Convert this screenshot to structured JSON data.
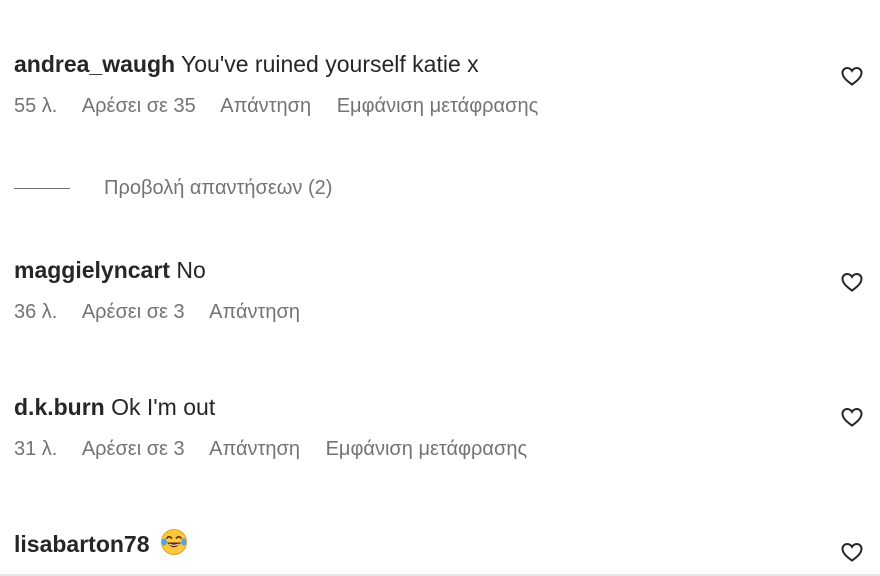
{
  "comments": [
    {
      "username": "andrea_waugh",
      "text": "You've ruined yourself katie x",
      "time": "55 λ.",
      "likes": "Αρέσει σε 35",
      "reply": "Απάντηση",
      "translate": "Εμφάνιση μετάφρασης"
    },
    {
      "username": "maggielyncart",
      "text": "No",
      "time": "36 λ.",
      "likes": "Αρέσει σε 3",
      "reply": "Απάντηση"
    },
    {
      "username": "d.k.burn",
      "text": "Ok I'm out",
      "time": "31 λ.",
      "likes": "Αρέσει σε 3",
      "reply": "Απάντηση",
      "translate": "Εμφάνιση μετάφρασης"
    },
    {
      "username": "lisabarton78",
      "text": "",
      "emoji": "tears-of-joy-emoji"
    }
  ],
  "view_replies": "Προβολή απαντήσεων (2)",
  "colors": {
    "text": "#262626",
    "secondary": "#737373",
    "emoji_face": "#FFC83D"
  },
  "icons": {
    "like": "heart-outline-icon"
  }
}
